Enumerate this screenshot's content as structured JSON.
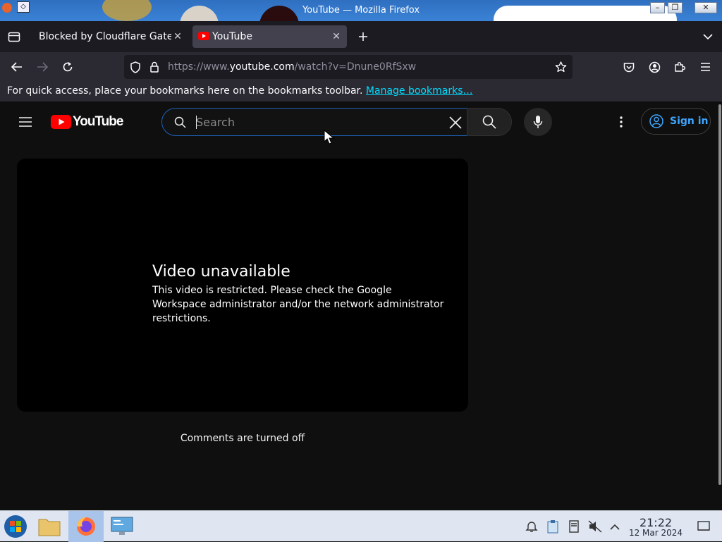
{
  "window": {
    "title": "YouTube — Mozilla Firefox"
  },
  "tabs": [
    {
      "label": "Blocked by Cloudflare Gateway",
      "active": false
    },
    {
      "label": "YouTube",
      "active": true
    }
  ],
  "url": {
    "prefix": "https://www.",
    "host": "youtube.com",
    "path": "/watch?v=Dnune0RfSxw"
  },
  "bookmarks": {
    "message": "For quick access, place your bookmarks here on the bookmarks toolbar. ",
    "link": "Manage bookmarks…"
  },
  "youtube": {
    "logo_text": "YouTube",
    "search_placeholder": "Search",
    "sign_in": "Sign in",
    "error_title": "Video unavailable",
    "error_message": "This video is restricted. Please check the Google Workspace administrator and/or the network administrator restrictions.",
    "comments": "Comments are turned off"
  },
  "clock": {
    "time": "21:22",
    "date": "12 Mar 2024"
  },
  "colors": {
    "youtube_red": "#ff0000",
    "link_blue": "#3ea6ff",
    "accent_cyan": "#00ddff"
  }
}
